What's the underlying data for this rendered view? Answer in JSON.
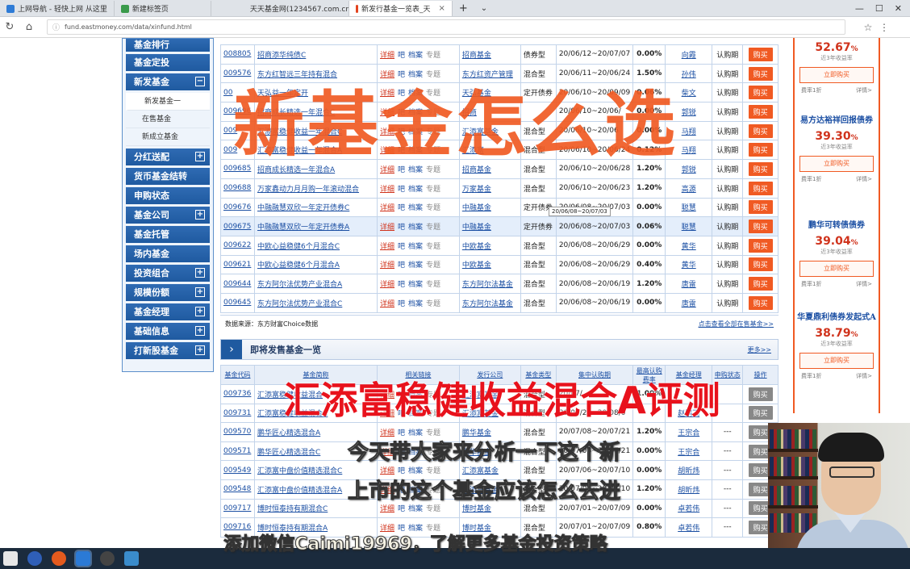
{
  "browser": {
    "tabs": [
      {
        "label": "上网导航 - 轻快上网 从这里"
      },
      {
        "label": "新建标签页"
      },
      {
        "label": "天天基金网(1234567.com.cn)"
      },
      {
        "label": "新发行基金一览表_天"
      }
    ],
    "url": "fund.eastmoney.com/data/xinfund.html"
  },
  "sidebar": {
    "items": [
      {
        "label": "基金排行"
      },
      {
        "label": "基金定投"
      },
      {
        "label": "新发基金"
      },
      {
        "label": "新发基金一"
      },
      {
        "label": "在售基金"
      },
      {
        "label": "新成立基金"
      },
      {
        "label": "分红送配"
      },
      {
        "label": "货币基金结转"
      },
      {
        "label": "申购状态"
      },
      {
        "label": "基金公司"
      },
      {
        "label": "基金托管"
      },
      {
        "label": "场内基金"
      },
      {
        "label": "投资组合"
      },
      {
        "label": "规模份额"
      },
      {
        "label": "基金经理"
      },
      {
        "label": "基础信息"
      },
      {
        "label": "打新股基金"
      }
    ]
  },
  "table1": {
    "link_detail": "详细",
    "link_ba": "吧",
    "link_archive": "档案",
    "link_topic": "专题",
    "buy_label": "购买",
    "rows": [
      {
        "code": "008805",
        "name": "招商添华纯债C",
        "company": "招商基金",
        "type": "债券型",
        "period": "20/06/12~20/07/07",
        "fee": "0.00%",
        "manager": "向霞",
        "status": "认购期"
      },
      {
        "code": "009576",
        "name": "东方红智远三年持有混合",
        "company": "东方红资产管理",
        "type": "混合型",
        "period": "20/06/11~20/06/24",
        "fee": "1.50%",
        "manager": "孙伟",
        "status": "认购期"
      },
      {
        "code": "00",
        "name": "天弘益一年定开",
        "company": "天弘基金",
        "type": "定开债券",
        "period": "20/06/10~20/09/09",
        "fee": "0.06%",
        "manager": "柴文",
        "status": "认购期"
      },
      {
        "code": "009696",
        "name": "招商成长精选一年混合C",
        "company": "招商",
        "type": "",
        "period": "20/06/10~20/06/",
        "fee": "0.00%",
        "manager": "郭锐",
        "status": "认购期"
      },
      {
        "code": "009",
        "name": "汇添富稳健收益一年混合C",
        "company": "汇添富基金",
        "type": "混合型",
        "period": "20/06/10~20/06",
        "fee": "0.00%",
        "manager": "马翔",
        "status": "认购期"
      },
      {
        "code": "009",
        "name": "汇添富稳健收益一年混合A",
        "company": "汇添富",
        "type": "混合型",
        "period": "20/06/10~20/06/24",
        "fee": "0.12%",
        "manager": "马翔",
        "status": "认购期"
      },
      {
        "code": "009685",
        "name": "招商成长精选一年混合A",
        "company": "招商基金",
        "type": "混合型",
        "period": "20/06/10~20/06/28",
        "fee": "1.20%",
        "manager": "郭锐",
        "status": "认购期"
      },
      {
        "code": "009688",
        "name": "万家鑫动力月月购一年滚动混合",
        "company": "万家基金",
        "type": "混合型",
        "period": "20/06/10~20/06/23",
        "fee": "1.20%",
        "manager": "高源",
        "status": "认购期"
      },
      {
        "code": "009676",
        "name": "中融融慧双欣一年定开债券C",
        "company": "中融基金",
        "type": "定开债券",
        "period": "20/06/08~20/07/03",
        "fee": "0.00%",
        "manager": "聪慧",
        "status": "认购期"
      },
      {
        "code": "009675",
        "name": "中融融慧双欣一年定开债券A",
        "company": "中融基金",
        "type": "定开债券",
        "period": "20/06/08~20/07/03",
        "fee": "0.06%",
        "manager": "聪慧",
        "status": "认购期"
      },
      {
        "code": "009622",
        "name": "中欧心益稳健6个月混合C",
        "company": "中欧基金",
        "type": "混合型",
        "period": "20/06/08~20/06/29",
        "fee": "0.00%",
        "manager": "黄华",
        "status": "认购期"
      },
      {
        "code": "009621",
        "name": "中欧心益稳健6个月混合A",
        "company": "中欧基金",
        "type": "混合型",
        "period": "20/06/08~20/06/29",
        "fee": "0.40%",
        "manager": "黄华",
        "status": "认购期"
      },
      {
        "code": "009644",
        "name": "东方阿尔法优势产业混合A",
        "company": "东方阿尔法基金",
        "type": "混合型",
        "period": "20/06/08~20/06/19",
        "fee": "1.20%",
        "manager": "唐雷",
        "status": "认购期"
      },
      {
        "code": "009645",
        "name": "东方阿尔法优势产业混合C",
        "company": "东方阿尔法基金",
        "type": "混合型",
        "period": "20/06/08~20/06/19",
        "fee": "0.00%",
        "manager": "唐雷",
        "status": "认购期"
      }
    ],
    "tooltip": "20/06/08~20/07/03",
    "source": "数据来源：东方财富Choice数据",
    "see_all": "点击查看全部在售基金>>"
  },
  "section2": {
    "title": "即将发售基金一览",
    "more": "更多>>",
    "headers": [
      "基金代码",
      "基金简称",
      "相关链接",
      "发行公司",
      "基金类型",
      "集中认购期",
      "最高认购费率",
      "基金经理",
      "申购状态",
      "操作"
    ],
    "rows": [
      {
        "code": "009736",
        "name": "汇添富稳健收益混合",
        "company": "汇添富基金",
        "type": "混合型",
        "period": "20/07/",
        "fee": "1.00%",
        "manager": "",
        "status": ""
      },
      {
        "code": "009731",
        "name": "汇添富稳健收益混合C",
        "company": "汇添富基金",
        "type": "混合型",
        "period": "20/07/28~20/08/0",
        "fee": "",
        "manager": "赵鹏飞",
        "status": ""
      },
      {
        "code": "009570",
        "name": "鹏华匠心精选混合A",
        "company": "鹏华基金",
        "type": "混合型",
        "period": "20/07/08~20/07/21",
        "fee": "1.20%",
        "manager": "王宗合",
        "status": "---"
      },
      {
        "code": "009571",
        "name": "鹏华匠心精选混合C",
        "company": "鹏华基金",
        "type": "混合型",
        "period": "20/07/08~20/07/21",
        "fee": "0.00%",
        "manager": "王宗合",
        "status": "---"
      },
      {
        "code": "009549",
        "name": "汇添富中盘价值精选混合C",
        "company": "汇添富基金",
        "type": "混合型",
        "period": "20/07/06~20/07/10",
        "fee": "0.00%",
        "manager": "胡昕炜",
        "status": "---"
      },
      {
        "code": "009548",
        "name": "汇添富中盘价值精选混合A",
        "company": "汇添富基金",
        "type": "混合型",
        "period": "20/07/06~20/07/10",
        "fee": "1.20%",
        "manager": "胡昕炜",
        "status": "---"
      },
      {
        "code": "009717",
        "name": "博时恒泰持有期混合C",
        "company": "博时基金",
        "type": "混合型",
        "period": "20/07/01~20/07/09",
        "fee": "0.00%",
        "manager": "卓若伟",
        "status": "---"
      },
      {
        "code": "009716",
        "name": "博时恒泰持有期混合A",
        "company": "博时基金",
        "type": "混合型",
        "period": "20/07/01~20/07/09",
        "fee": "0.80%",
        "manager": "卓若伟",
        "status": "---"
      }
    ]
  },
  "right_panel": {
    "items": [
      {
        "name": "",
        "rate": "52.67",
        "caption": "近3年收益率",
        "button": "立即购买",
        "fee": "费率1折",
        "detail": "详情>"
      },
      {
        "name": "易方达裕祥回报债券",
        "rate": "39.30",
        "caption": "近3年收益率",
        "button": "立即购买",
        "fee": "费率1折",
        "detail": "详情>"
      },
      {
        "name": "鹏华可转债债券",
        "rate": "39.04",
        "caption": "近3年收益率",
        "button": "立即购买",
        "fee": "费率1折",
        "detail": "详情>"
      },
      {
        "name": "华夏鼎利债券发起式A",
        "rate": "38.79",
        "caption": "近3年收益率",
        "button": "立即购买",
        "fee": "费率1折",
        "detail": "详情>"
      }
    ],
    "percent": "%"
  },
  "overlay": {
    "title": "新基金怎么选",
    "subtitle": "汇添富稳健收益混合A评测",
    "caption1": "今天带大家来分析一下这个新",
    "caption2": "上市的这个基金应该怎么去进",
    "caption3": "添加微信Caimi19969，了解更多基金投资策略"
  },
  "colors": {
    "accent": "#f05a23",
    "nav_blue": "#1f5aa0",
    "link_blue": "#1b4fa3",
    "red": "#d0331c"
  }
}
